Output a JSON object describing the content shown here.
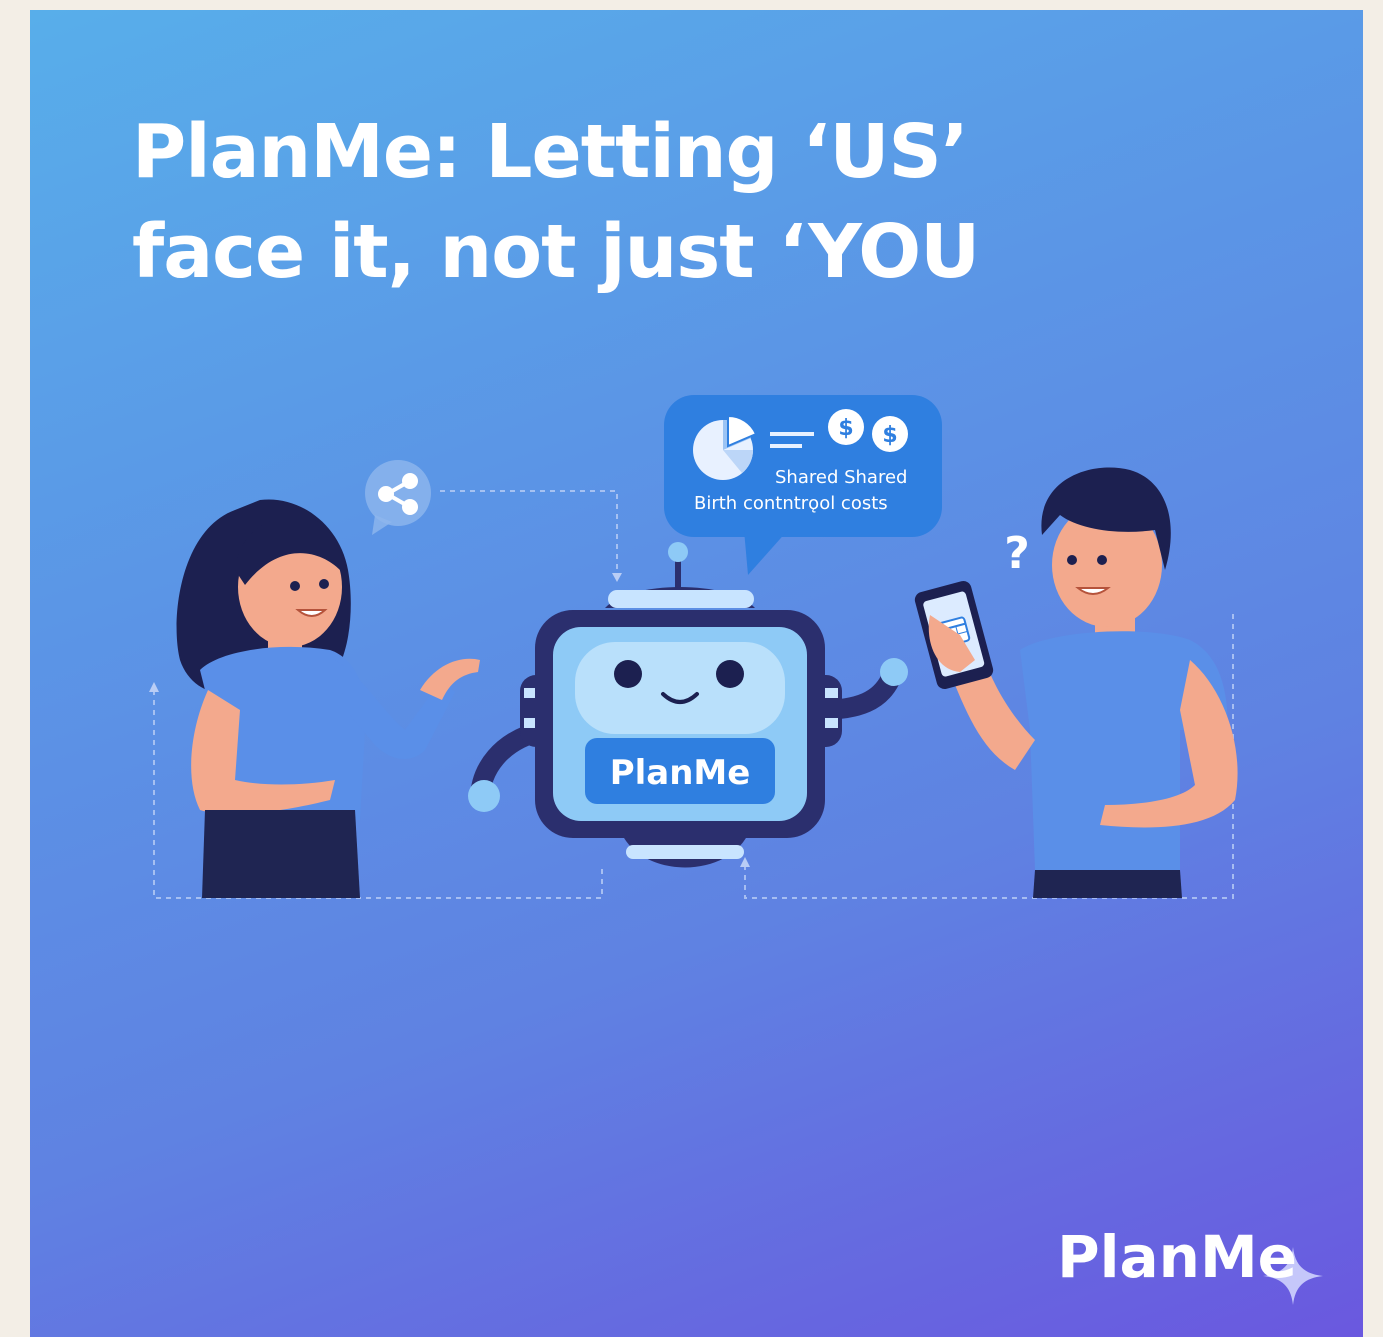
{
  "headline": {
    "line1": "PlanMe: Letting ‘US’",
    "line2": "face it, not just ‘YOU"
  },
  "speech_bubble": {
    "line1": "Shared Shared",
    "line2": "Birth contntrǫol costs",
    "currency_symbol": "$"
  },
  "robot": {
    "label": "PlanMe"
  },
  "man": {
    "question_mark": "?"
  },
  "brand_logo": {
    "text": "PlanMe"
  },
  "icons": [
    "share-icon",
    "pie-chart-icon",
    "dollar-coin-icon",
    "calendar-icon",
    "sparkle-icon"
  ],
  "colors": {
    "background_top": "#58aeea",
    "background_bottom": "#6a58df",
    "shirt_blue": "#5a8fe8",
    "robot_dark": "#2b2f6e",
    "robot_screen": "#8ecaf6",
    "pants_dark": "#1f2552",
    "skin": "#f3a98d"
  }
}
